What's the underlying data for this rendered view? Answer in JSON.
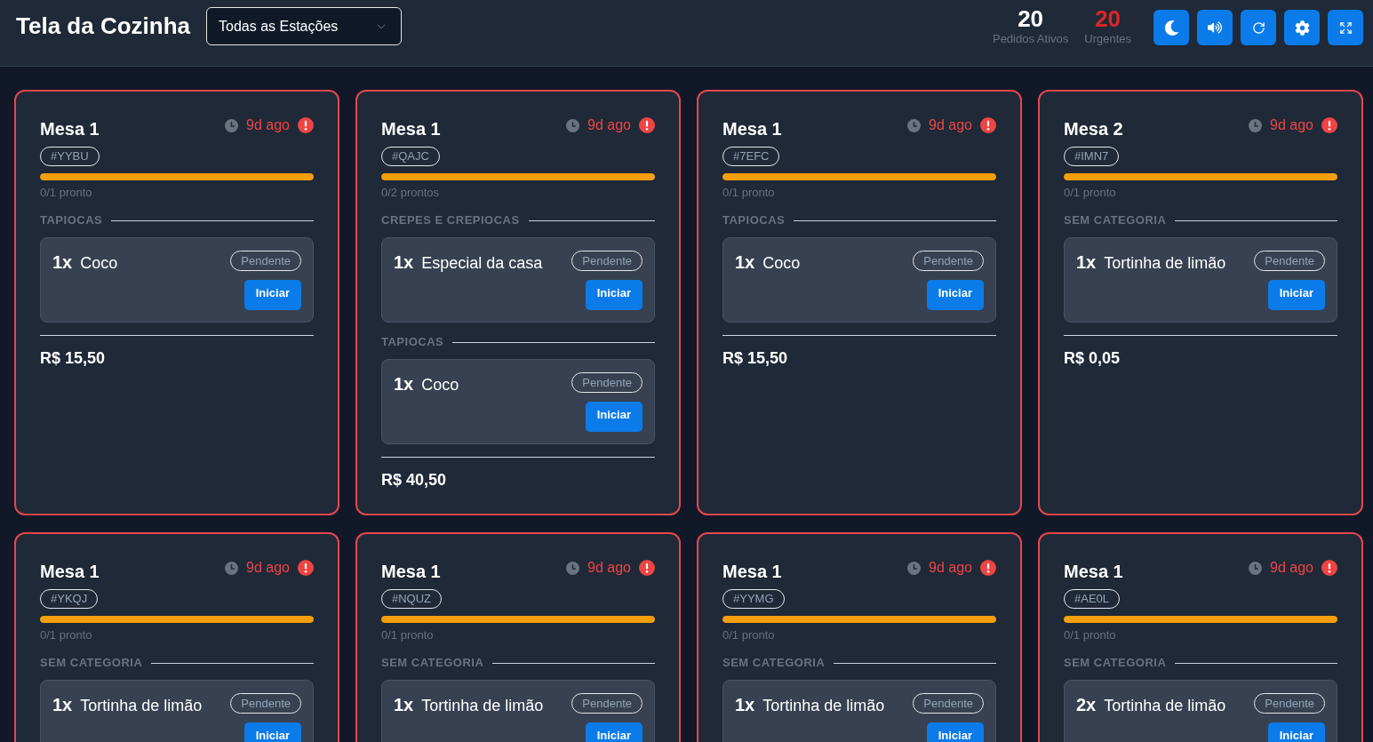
{
  "header": {
    "title": "Tela da Cozinha",
    "station_select": {
      "value": "Todas as Estações"
    },
    "stats": [
      {
        "kind": "total",
        "value": "20",
        "label": "Pedidos Ativos"
      },
      {
        "kind": "urgent",
        "value": "20",
        "label": "Urgentes"
      }
    ]
  },
  "orders": [
    {
      "table": "Mesa 1",
      "elapsed": "9d ago",
      "urgent": true,
      "code": "#YYBU",
      "level": 1,
      "progress_text": "0/1 pronto",
      "sections": [
        {
          "name": "TAPIOCAS",
          "items": [
            {
              "quantity": "1x",
              "name": "Coco",
              "status": "Pendente",
              "action": "Iniciar"
            }
          ]
        }
      ],
      "total": "R$ 15,50"
    },
    {
      "table": "Mesa 1",
      "elapsed": "9d ago",
      "urgent": true,
      "code": "#QAJC",
      "level": 1,
      "progress_text": "0/2 prontos",
      "sections": [
        {
          "name": "CREPES E CREPIOCAS",
          "items": [
            {
              "quantity": "1x",
              "name": "Especial da casa",
              "status": "Pendente",
              "action": "Iniciar"
            }
          ]
        },
        {
          "name": "TAPIOCAS",
          "items": [
            {
              "quantity": "1x",
              "name": "Coco",
              "status": "Pendente",
              "action": "Iniciar"
            }
          ]
        }
      ],
      "total": "R$ 40,50"
    },
    {
      "table": "Mesa 1",
      "elapsed": "9d ago",
      "urgent": true,
      "code": "#7EFC",
      "level": 1,
      "progress_text": "0/1 pronto",
      "sections": [
        {
          "name": "TAPIOCAS",
          "items": [
            {
              "quantity": "1x",
              "name": "Coco",
              "status": "Pendente",
              "action": "Iniciar"
            }
          ]
        }
      ],
      "total": "R$ 15,50"
    },
    {
      "table": "Mesa 2",
      "elapsed": "9d ago",
      "urgent": true,
      "code": "#IMN7",
      "level": 1,
      "progress_text": "0/1 pronto",
      "sections": [
        {
          "name": "SEM CATEGORIA",
          "items": [
            {
              "quantity": "1x",
              "name": "Tortinha de limão",
              "status": "Pendente",
              "action": "Iniciar"
            }
          ]
        }
      ],
      "total": "R$ 0,05"
    },
    {
      "table": "Mesa 1",
      "elapsed": "9d ago",
      "urgent": true,
      "code": "#YKQJ",
      "level": 1,
      "progress_text": "0/1 pronto",
      "sections": [
        {
          "name": "SEM CATEGORIA",
          "items": [
            {
              "quantity": "1x",
              "name": "Tortinha de limão",
              "status": "Pendente",
              "action": "Iniciar"
            }
          ]
        }
      ]
    },
    {
      "table": "Mesa 1",
      "elapsed": "9d ago",
      "urgent": true,
      "code": "#NQUZ",
      "level": 1,
      "progress_text": "0/1 pronto",
      "sections": [
        {
          "name": "SEM CATEGORIA",
          "items": [
            {
              "quantity": "1x",
              "name": "Tortinha de limão",
              "status": "Pendente",
              "action": "Iniciar"
            }
          ]
        }
      ]
    },
    {
      "table": "Mesa 1",
      "elapsed": "9d ago",
      "urgent": true,
      "code": "#YYMG",
      "level": 1,
      "progress_text": "0/1 pronto",
      "sections": [
        {
          "name": "SEM CATEGORIA",
          "items": [
            {
              "quantity": "1x",
              "name": "Tortinha de limão",
              "status": "Pendente",
              "action": "Iniciar"
            }
          ]
        }
      ]
    },
    {
      "table": "Mesa 1",
      "elapsed": "9d ago",
      "urgent": true,
      "code": "#AE0L",
      "level": 1,
      "progress_text": "0/1 pronto",
      "sections": [
        {
          "name": "SEM CATEGORIA",
          "items": [
            {
              "quantity": "2x",
              "name": "Tortinha de limão",
              "status": "Pendente",
              "action": "Iniciar"
            }
          ]
        }
      ]
    }
  ]
}
